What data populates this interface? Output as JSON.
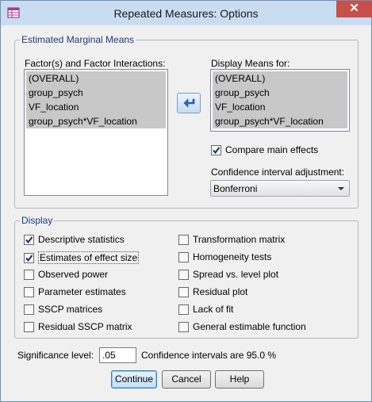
{
  "window": {
    "title": "Repeated Measures: Options",
    "close_glyph": "✕"
  },
  "emm": {
    "legend": "Estimated Marginal Means",
    "factors_label": "Factor(s) and Factor Interactions:",
    "factors": [
      "(OVERALL)",
      "group_psych",
      "VF_location",
      "group_psych*VF_location"
    ],
    "display_label": "Display Means for:",
    "display_items": [
      "(OVERALL)",
      "group_psych",
      "VF_location",
      "group_psych*VF_location"
    ],
    "move_icon": "arrow-left-icon",
    "compare_main_effects": {
      "label": "Compare main effects",
      "checked": true
    },
    "ci_adjustment_label": "Confidence interval adjustment:",
    "ci_adjustment_value": "Bonferroni"
  },
  "display": {
    "legend": "Display",
    "left": [
      {
        "label": "Descriptive statistics",
        "checked": true
      },
      {
        "label": "Estimates of effect size",
        "checked": true
      },
      {
        "label": "Observed power",
        "checked": false
      },
      {
        "label": "Parameter estimates",
        "checked": false
      },
      {
        "label": "SSCP matrices",
        "checked": false
      },
      {
        "label": "Residual SSCP matrix",
        "checked": false
      }
    ],
    "right": [
      {
        "label": "Transformation matrix",
        "checked": false
      },
      {
        "label": "Homogeneity tests",
        "checked": false
      },
      {
        "label": "Spread vs. level plot",
        "checked": false
      },
      {
        "label": "Residual plot",
        "checked": false
      },
      {
        "label": "Lack of fit",
        "checked": false
      },
      {
        "label": "General estimable function",
        "checked": false
      }
    ]
  },
  "significance": {
    "label": "Significance level:",
    "value": ".05",
    "ci_text": "Confidence intervals are 95.0 %"
  },
  "buttons": {
    "continue": "Continue",
    "cancel": "Cancel",
    "help": "Help"
  },
  "colors": {
    "accent": "#1c3b7a",
    "selection": "#c8c8c8",
    "close": "#c7504a"
  }
}
